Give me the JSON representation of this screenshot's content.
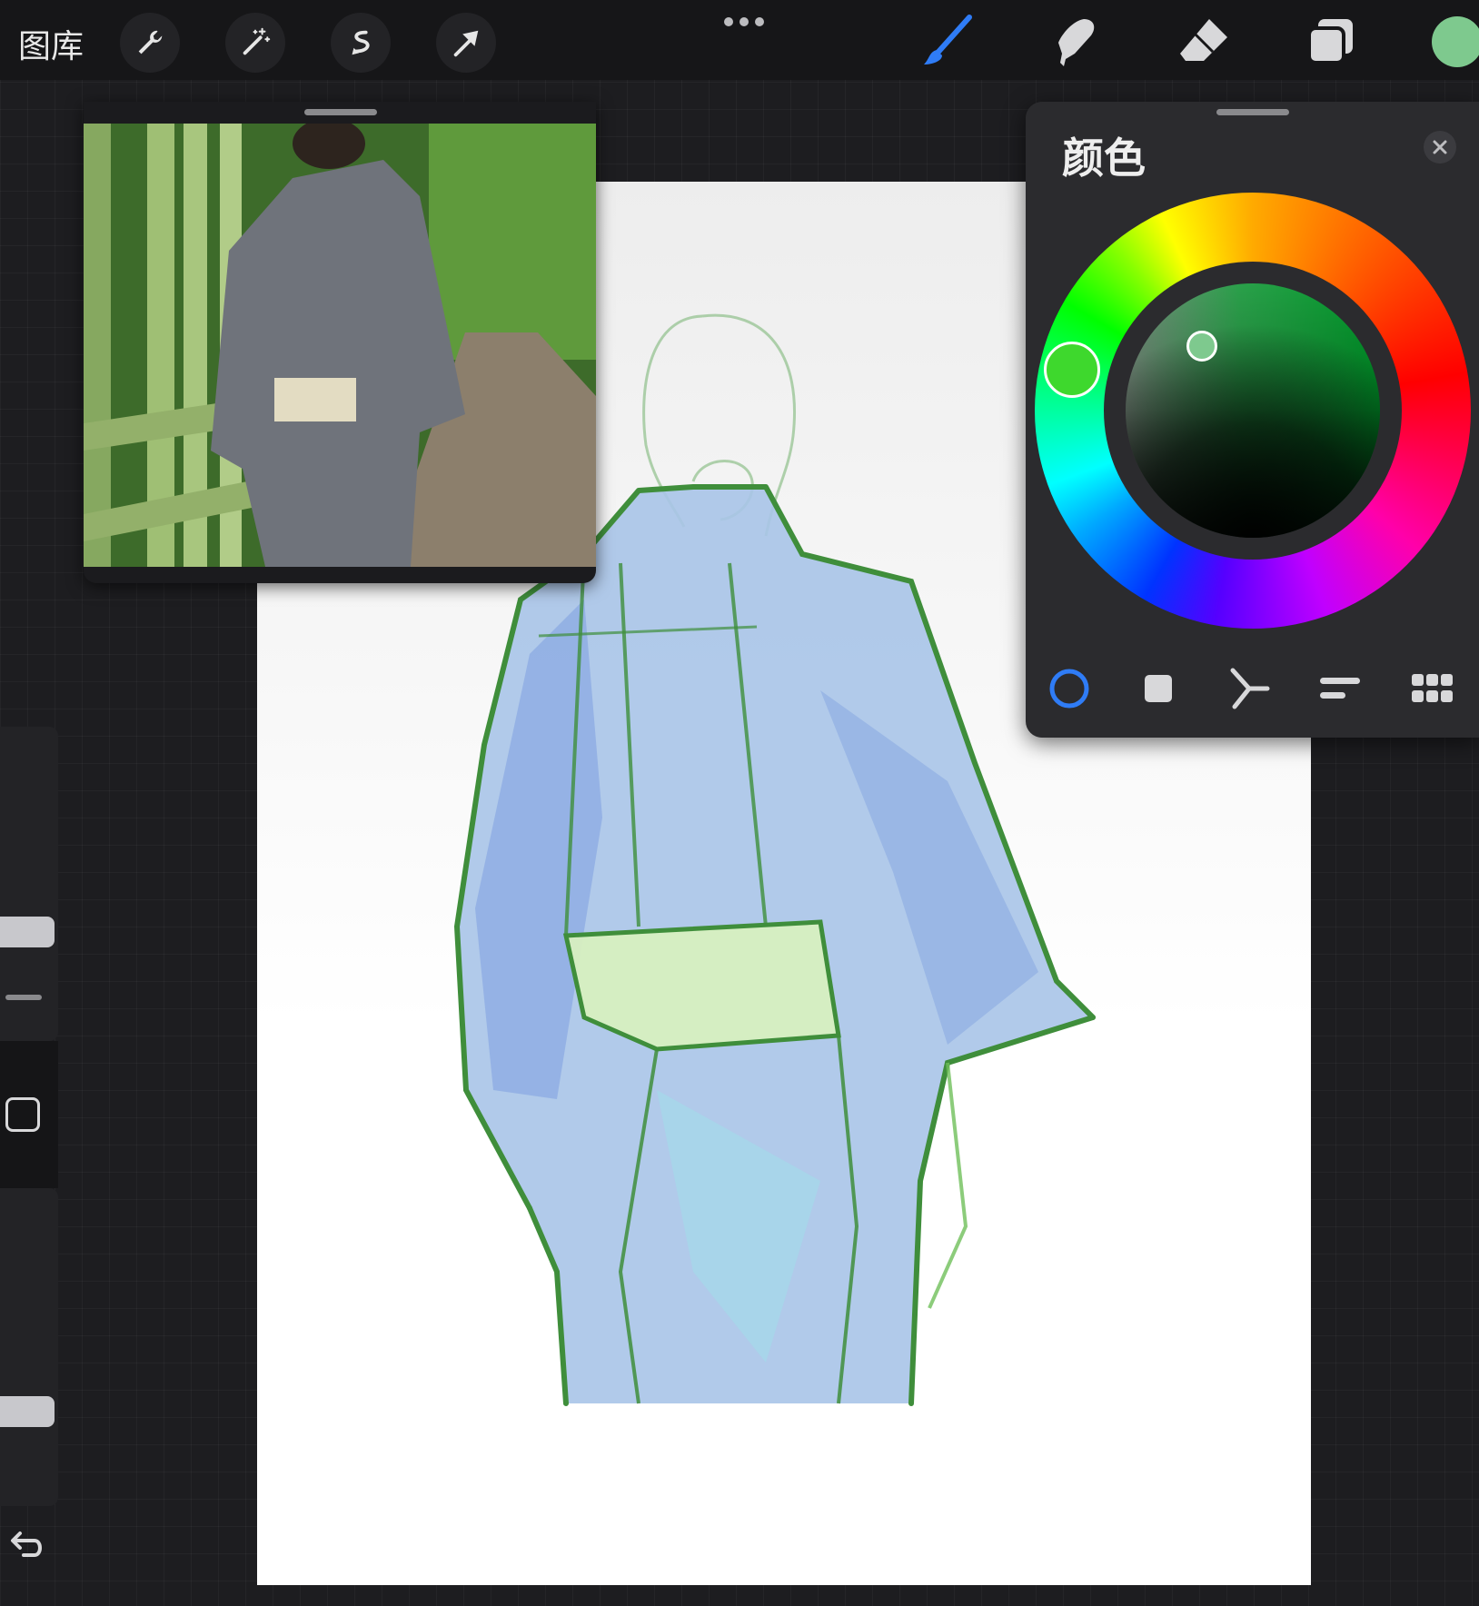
{
  "topbar": {
    "gallery_label": "图库",
    "left_tools": [
      {
        "icon": "wrench-icon"
      },
      {
        "icon": "magic-wand-icon"
      },
      {
        "icon": "selection-icon"
      },
      {
        "icon": "transform-arrow-icon"
      }
    ],
    "right_tools": [
      {
        "icon": "brush-icon",
        "active": true,
        "color": "#2f7cf6"
      },
      {
        "icon": "smudge-icon"
      },
      {
        "icon": "eraser-icon"
      },
      {
        "icon": "layers-icon"
      }
    ],
    "current_color": "#7ec98e"
  },
  "color_panel": {
    "title": "颜色",
    "close_icon": "close-icon",
    "selected_hue_color": "#3ed82d",
    "selected_color": "#7ec98e",
    "tabs": [
      {
        "icon": "disc-icon",
        "active": true
      },
      {
        "icon": "classic-square-icon"
      },
      {
        "icon": "harmony-icon"
      },
      {
        "icon": "value-sliders-icon"
      },
      {
        "icon": "palettes-grid-icon"
      }
    ],
    "accent_color": "#2f7cf6"
  },
  "reference_window": {
    "icon": "reference-photo"
  },
  "sidebar": {
    "icons": [
      "modify-square-icon",
      "undo-icon"
    ]
  }
}
